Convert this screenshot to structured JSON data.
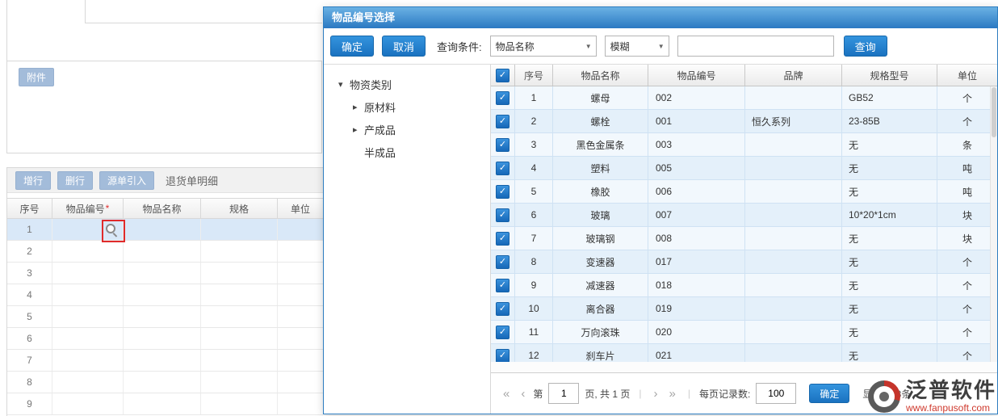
{
  "icons": {
    "check": "✓",
    "select_arrow": "▼",
    "expanded": "▾",
    "collapsed": "▸",
    "first": "«",
    "prev": "‹",
    "next": "›",
    "last": "»",
    "sep": "|"
  },
  "background": {
    "attachment_label": "附件",
    "toolbar": {
      "add_row": "增行",
      "delete_row": "删行",
      "source_import": "源单引入",
      "detail_title": "退货单明细"
    },
    "table": {
      "headers": {
        "no": "序号",
        "code": "物品编号",
        "required_mark": "*",
        "name": "物品名称",
        "spec": "规格",
        "unit": "单位"
      },
      "rows": [
        "1",
        "2",
        "3",
        "4",
        "5",
        "6",
        "7",
        "8",
        "9"
      ]
    }
  },
  "dialog": {
    "title": "物品编号选择",
    "toolbar": {
      "confirm": "确定",
      "cancel": "取消",
      "query_condition_label": "查询条件:",
      "field_select": "物品名称",
      "match_select": "模糊",
      "search_value": "",
      "query": "查询"
    },
    "tree": {
      "root": "物资类别",
      "children": [
        "原材料",
        "产成品",
        "半成品"
      ]
    },
    "table": {
      "headers": [
        "序号",
        "物品名称",
        "物品编号",
        "品牌",
        "规格型号",
        "单位"
      ],
      "rows": [
        {
          "no": "1",
          "name": "螺母",
          "code": "002",
          "brand": "",
          "spec": "GB52",
          "unit": "个"
        },
        {
          "no": "2",
          "name": "螺栓",
          "code": "001",
          "brand": "恒久系列",
          "spec": "23-85B",
          "unit": "个"
        },
        {
          "no": "3",
          "name": "黑色金属条",
          "code": "003",
          "brand": "",
          "spec": "无",
          "unit": "条"
        },
        {
          "no": "4",
          "name": "塑料",
          "code": "005",
          "brand": "",
          "spec": "无",
          "unit": "吨"
        },
        {
          "no": "5",
          "name": "橡胶",
          "code": "006",
          "brand": "",
          "spec": "无",
          "unit": "吨"
        },
        {
          "no": "6",
          "name": "玻璃",
          "code": "007",
          "brand": "",
          "spec": "10*20*1cm",
          "unit": "块"
        },
        {
          "no": "7",
          "name": "玻璃钢",
          "code": "008",
          "brand": "",
          "spec": "无",
          "unit": "块"
        },
        {
          "no": "8",
          "name": "变速器",
          "code": "017",
          "brand": "",
          "spec": "无",
          "unit": "个"
        },
        {
          "no": "9",
          "name": "减速器",
          "code": "018",
          "brand": "",
          "spec": "无",
          "unit": "个"
        },
        {
          "no": "10",
          "name": "离合器",
          "code": "019",
          "brand": "",
          "spec": "无",
          "unit": "个"
        },
        {
          "no": "11",
          "name": "万向滚珠",
          "code": "020",
          "brand": "",
          "spec": "无",
          "unit": "个"
        },
        {
          "no": "12",
          "name": "刹车片",
          "code": "021",
          "brand": "",
          "spec": "无",
          "unit": "个"
        }
      ]
    },
    "pagination": {
      "page_prefix": "第",
      "page_value": "1",
      "page_suffix": "页, 共 1 页",
      "per_page_label": "每页记录数:",
      "per_page_value": "100",
      "confirm": "确定",
      "total_label": "显示1-98条"
    }
  },
  "watermark": {
    "brand": "泛普软件",
    "url": "www.fanpusoft.com"
  }
}
